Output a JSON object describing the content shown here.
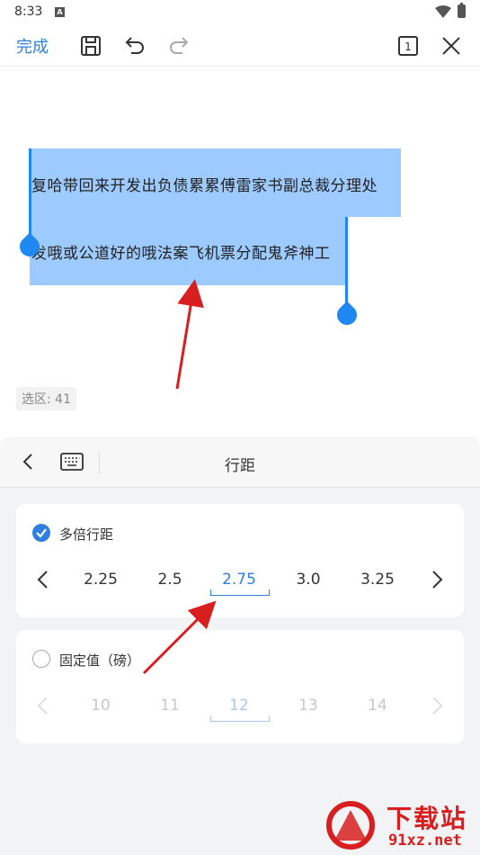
{
  "status_bar": {
    "time": "8:33",
    "notification_icon": "A"
  },
  "toolbar": {
    "done_label": "完成",
    "icons": [
      "save-icon",
      "undo-icon",
      "redo-icon",
      "page-1-icon",
      "close-icon"
    ],
    "page_number": "1"
  },
  "document": {
    "line1": "复哈带回来开发出负债累累傅雷家书副总裁分理处",
    "line2": "发哦或公道好的哦法案飞机票分配鬼斧神工",
    "selection_count": "选区: 41"
  },
  "panel": {
    "title": "行距",
    "multiple_spacing": {
      "label": "多倍行距",
      "checked": true,
      "options": [
        "2.25",
        "2.5",
        "2.75",
        "3.0",
        "3.25"
      ],
      "selected": "2.75"
    },
    "fixed_spacing": {
      "label": "固定值（磅）",
      "checked": false,
      "options": [
        "10",
        "11",
        "12",
        "13",
        "14"
      ],
      "selected": "12"
    }
  },
  "watermark": {
    "title": "下载站",
    "url": "91xz.net"
  },
  "colors": {
    "accent": "#2f7fe0",
    "selection": "#9ecbff",
    "annotation": "#d81e1e"
  }
}
